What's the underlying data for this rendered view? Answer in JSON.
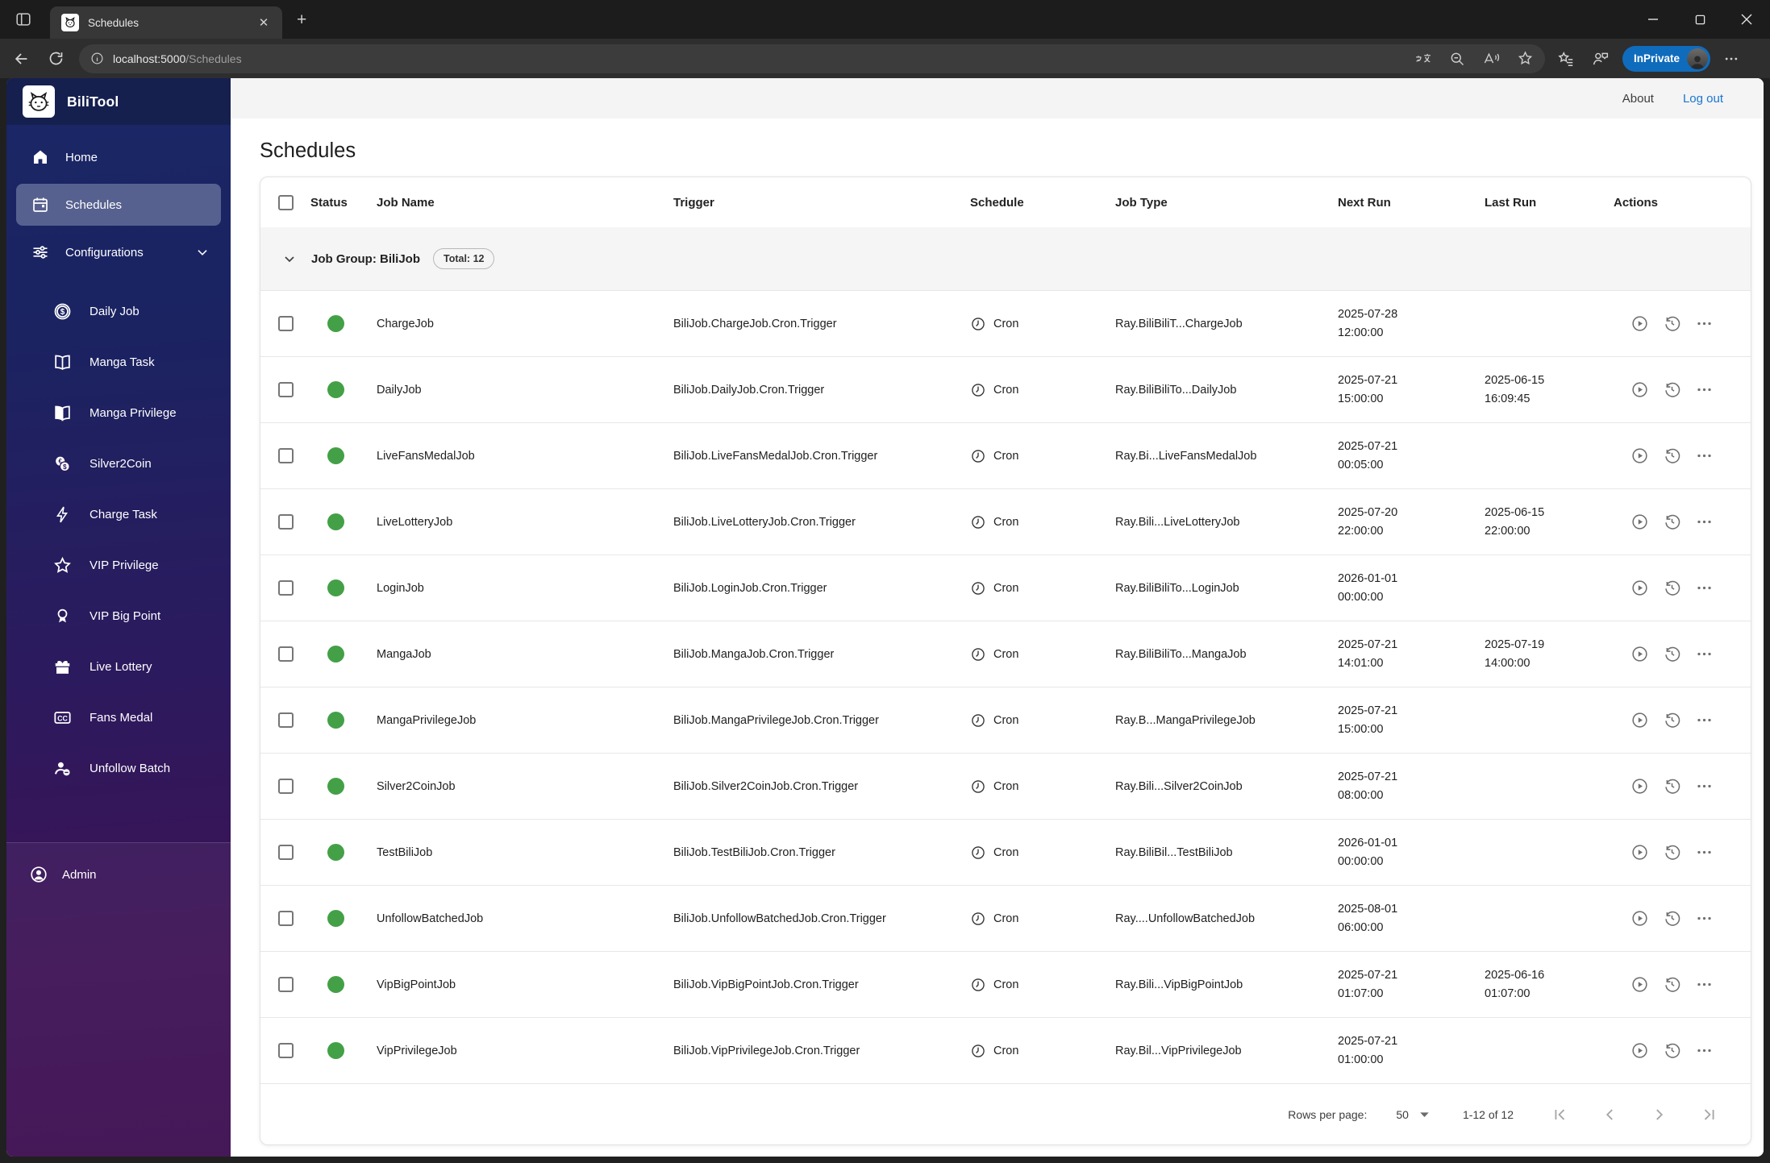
{
  "browser": {
    "tab_title": "Schedules",
    "url_host": "localhost:5000",
    "url_path": "/Schedules",
    "inprivate_label": "InPrivate"
  },
  "appbar": {
    "about": "About",
    "logout": "Log out"
  },
  "sidebar": {
    "brand": "BiliTool",
    "home_label": "Home",
    "schedules_label": "Schedules",
    "configurations_label": "Configurations",
    "config_items": [
      {
        "icon": "coin-dollar-icon",
        "label": "Daily Job"
      },
      {
        "icon": "book-open-icon",
        "label": "Manga Task"
      },
      {
        "icon": "book-filled-icon",
        "label": "Manga Privilege"
      },
      {
        "icon": "coins-icon",
        "label": "Silver2Coin"
      },
      {
        "icon": "lightning-icon",
        "label": "Charge Task"
      },
      {
        "icon": "star-icon",
        "label": "VIP Privilege"
      },
      {
        "icon": "medal-icon",
        "label": "VIP Big Point"
      },
      {
        "icon": "gift-icon",
        "label": "Live Lottery"
      },
      {
        "icon": "cc-badge-icon",
        "label": "Fans Medal"
      },
      {
        "icon": "person-remove-icon",
        "label": "Unfollow Batch"
      }
    ],
    "admin_label": "Admin"
  },
  "page": {
    "title": "Schedules"
  },
  "table": {
    "columns": [
      "Status",
      "Job Name",
      "Trigger",
      "Schedule",
      "Job Type",
      "Next Run",
      "Last Run",
      "Actions"
    ],
    "group": {
      "label": "Job Group: BiliJob",
      "badge": "Total: 12"
    },
    "rows": [
      {
        "name": "ChargeJob",
        "trigger": "BiliJob.ChargeJob.Cron.Trigger",
        "schedule": "Cron",
        "job_type": "Ray.BiliBiliT...ChargeJob",
        "next_run_date": "2025-07-28",
        "next_run_time": "12:00:00",
        "last_run_date": "",
        "last_run_time": ""
      },
      {
        "name": "DailyJob",
        "trigger": "BiliJob.DailyJob.Cron.Trigger",
        "schedule": "Cron",
        "job_type": "Ray.BiliBiliTo...DailyJob",
        "next_run_date": "2025-07-21",
        "next_run_time": "15:00:00",
        "last_run_date": "2025-06-15",
        "last_run_time": "16:09:45"
      },
      {
        "name": "LiveFansMedalJob",
        "trigger": "BiliJob.LiveFansMedalJob.Cron.Trigger",
        "schedule": "Cron",
        "job_type": "Ray.Bi...LiveFansMedalJob",
        "next_run_date": "2025-07-21",
        "next_run_time": "00:05:00",
        "last_run_date": "",
        "last_run_time": ""
      },
      {
        "name": "LiveLotteryJob",
        "trigger": "BiliJob.LiveLotteryJob.Cron.Trigger",
        "schedule": "Cron",
        "job_type": "Ray.Bili...LiveLotteryJob",
        "next_run_date": "2025-07-20",
        "next_run_time": "22:00:00",
        "last_run_date": "2025-06-15",
        "last_run_time": "22:00:00"
      },
      {
        "name": "LoginJob",
        "trigger": "BiliJob.LoginJob.Cron.Trigger",
        "schedule": "Cron",
        "job_type": "Ray.BiliBiliTo...LoginJob",
        "next_run_date": "2026-01-01",
        "next_run_time": "00:00:00",
        "last_run_date": "",
        "last_run_time": ""
      },
      {
        "name": "MangaJob",
        "trigger": "BiliJob.MangaJob.Cron.Trigger",
        "schedule": "Cron",
        "job_type": "Ray.BiliBiliTo...MangaJob",
        "next_run_date": "2025-07-21",
        "next_run_time": "14:01:00",
        "last_run_date": "2025-07-19",
        "last_run_time": "14:00:00"
      },
      {
        "name": "MangaPrivilegeJob",
        "trigger": "BiliJob.MangaPrivilegeJob.Cron.Trigger",
        "schedule": "Cron",
        "job_type": "Ray.B...MangaPrivilegeJob",
        "next_run_date": "2025-07-21",
        "next_run_time": "15:00:00",
        "last_run_date": "",
        "last_run_time": ""
      },
      {
        "name": "Silver2CoinJob",
        "trigger": "BiliJob.Silver2CoinJob.Cron.Trigger",
        "schedule": "Cron",
        "job_type": "Ray.Bili...Silver2CoinJob",
        "next_run_date": "2025-07-21",
        "next_run_time": "08:00:00",
        "last_run_date": "",
        "last_run_time": ""
      },
      {
        "name": "TestBiliJob",
        "trigger": "BiliJob.TestBiliJob.Cron.Trigger",
        "schedule": "Cron",
        "job_type": "Ray.BiliBil...TestBiliJob",
        "next_run_date": "2026-01-01",
        "next_run_time": "00:00:00",
        "last_run_date": "",
        "last_run_time": ""
      },
      {
        "name": "UnfollowBatchedJob",
        "trigger": "BiliJob.UnfollowBatchedJob.Cron.Trigger",
        "schedule": "Cron",
        "job_type": "Ray....UnfollowBatchedJob",
        "next_run_date": "2025-08-01",
        "next_run_time": "06:00:00",
        "last_run_date": "",
        "last_run_time": ""
      },
      {
        "name": "VipBigPointJob",
        "trigger": "BiliJob.VipBigPointJob.Cron.Trigger",
        "schedule": "Cron",
        "job_type": "Ray.Bili...VipBigPointJob",
        "next_run_date": "2025-07-21",
        "next_run_time": "01:07:00",
        "last_run_date": "2025-06-16",
        "last_run_time": "01:07:00"
      },
      {
        "name": "VipPrivilegeJob",
        "trigger": "BiliJob.VipPrivilegeJob.Cron.Trigger",
        "schedule": "Cron",
        "job_type": "Ray.Bil...VipPrivilegeJob",
        "next_run_date": "2025-07-21",
        "next_run_time": "01:00:00",
        "last_run_date": "",
        "last_run_time": ""
      }
    ]
  },
  "pagination": {
    "rows_per_page_label": "Rows per page:",
    "rows_per_page_value": "50",
    "range": "1-12 of 12"
  },
  "colors": {
    "status_green": "#43a047",
    "link_blue": "#1976d2",
    "inprivate_blue": "#0f6cbd",
    "sidebar_navy": "#1b2361",
    "sidebar_purple": "#3c0c50",
    "sidebar_selected": "#57618f",
    "appbar_gray": "#f4f4f4"
  }
}
